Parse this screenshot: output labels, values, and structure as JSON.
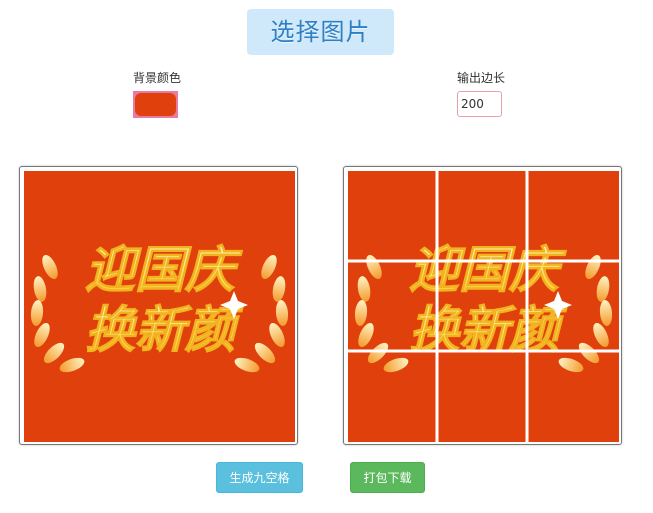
{
  "header": {
    "select_label": "选择图片"
  },
  "controls": {
    "bg_color_label": "背景颜色",
    "bg_color_value": "#e0410c",
    "output_size_label": "输出边长",
    "output_size_value": "200"
  },
  "poster": {
    "line1": "迎国庆",
    "line2": "换新颜",
    "background": "#e0410c"
  },
  "actions": {
    "generate_label": "生成九空格",
    "download_label": "打包下载"
  }
}
